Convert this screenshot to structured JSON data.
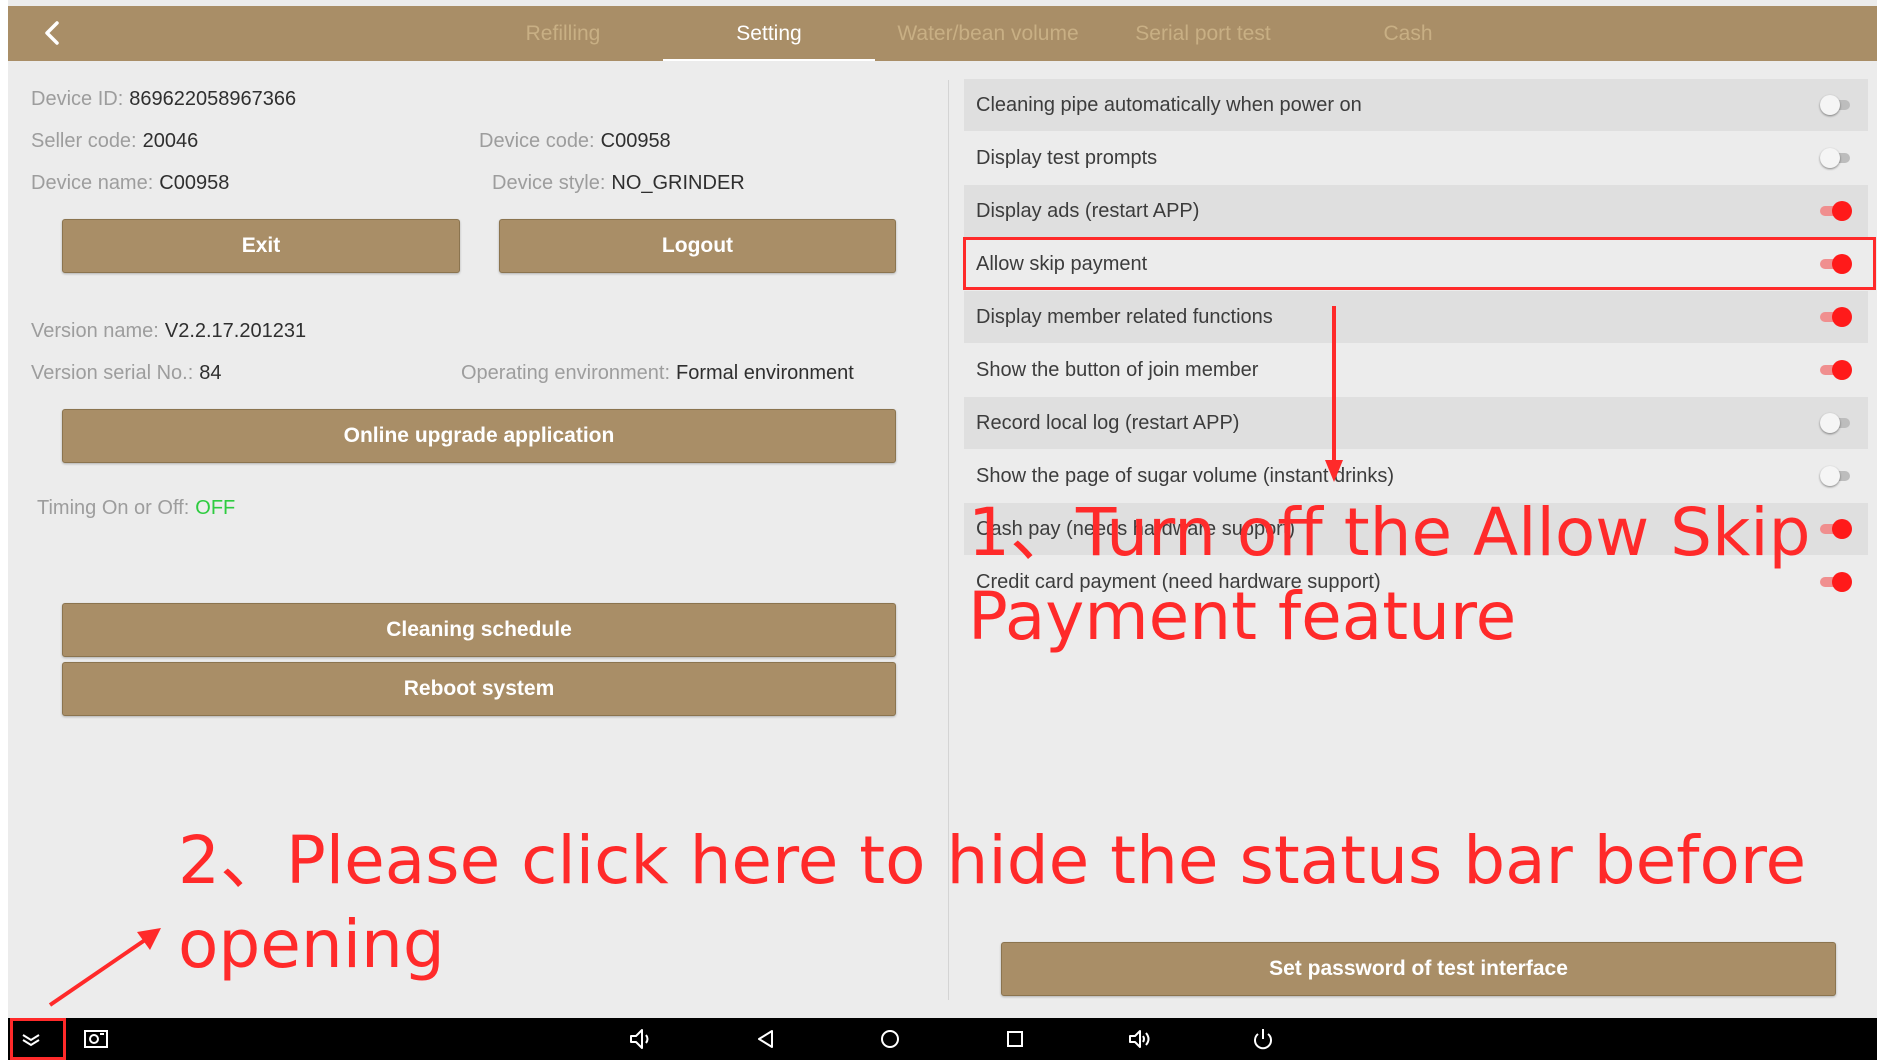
{
  "tabs": [
    "Refilling",
    "Setting",
    "Water/bean volume",
    "Serial port test",
    "Cash"
  ],
  "device": {
    "device_id_label": "Device ID:",
    "device_id": "869622058967366",
    "seller_code_label": "Seller code:",
    "seller_code": "20046",
    "device_code_label": "Device code:",
    "device_code": "C00958",
    "device_name_label": "Device name:",
    "device_name": "C00958",
    "device_style_label": "Device style:",
    "device_style": "NO_GRINDER"
  },
  "buttons": {
    "exit": "Exit",
    "logout": "Logout",
    "upgrade": "Online upgrade application",
    "cleaning": "Cleaning schedule",
    "reboot": "Reboot system",
    "set_password": "Set password of test interface"
  },
  "version": {
    "name_label": "Version name:",
    "name": "V2.2.17.201231",
    "serial_label": "Version serial No.:",
    "serial": "84",
    "env_label": "Operating environment:",
    "env": "Formal environment"
  },
  "timing": {
    "label": "Timing On or Off:",
    "value": "OFF",
    "value_color": "#2ecc40"
  },
  "settings": [
    {
      "label": "Cleaning pipe automatically when power on",
      "on": false
    },
    {
      "label": "Display test prompts",
      "on": false
    },
    {
      "label": "Display ads (restart APP)",
      "on": true
    },
    {
      "label": "Allow skip payment",
      "on": true
    },
    {
      "label": "Display member related functions",
      "on": true
    },
    {
      "label": "Show the button of join member",
      "on": true
    },
    {
      "label": "Record local log (restart APP)",
      "on": false
    },
    {
      "label": "Show the page of sugar volume (instant drinks)",
      "on": false
    },
    {
      "label": "Cash pay (needs hardware support)",
      "on": true
    },
    {
      "label": "Credit card payment (need hardware support)",
      "on": true
    }
  ],
  "annotations": {
    "step1_line1": "1、Turn off the Allow Skip",
    "step1_line2": "Payment feature",
    "step2_line1": "2、Please click here to hide the status bar before",
    "step2_line2": "opening"
  },
  "colors": {
    "accent": "#a98e67",
    "toggle_on": "#ff1a1a",
    "annotation": "#ff2a2a"
  },
  "nav_icons": [
    "hide-statusbar-icon",
    "screenshot-icon",
    "volume-down-icon",
    "back-icon",
    "home-icon",
    "recents-icon",
    "volume-up-icon",
    "power-icon"
  ]
}
